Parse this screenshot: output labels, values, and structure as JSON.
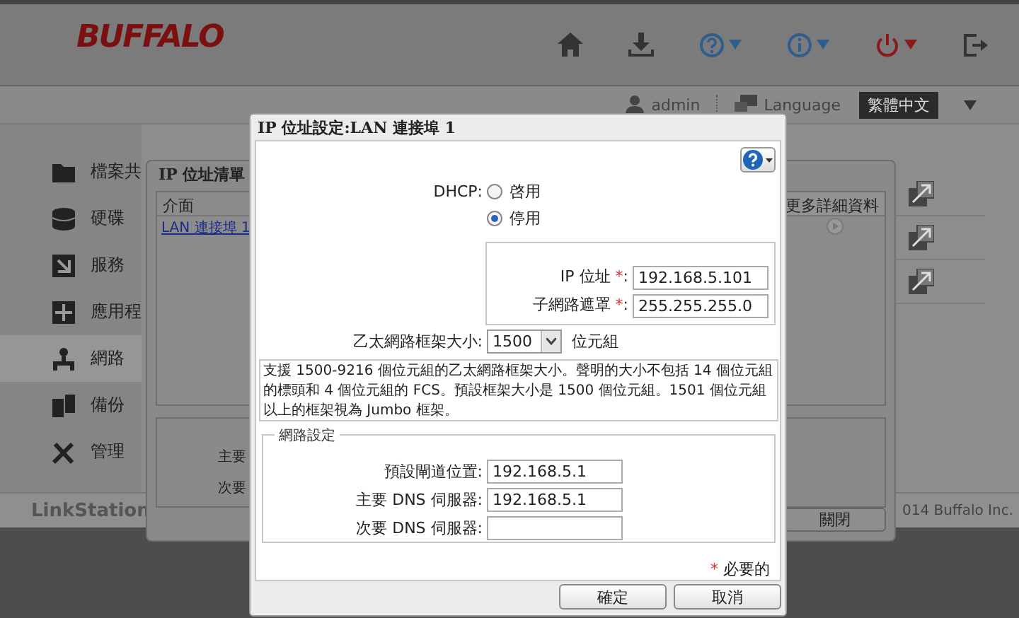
{
  "header": {
    "logo": "BUFFALO"
  },
  "user_bar": {
    "user": "admin",
    "language_label": "Language",
    "language": "繁體中文"
  },
  "sidebar": {
    "items": [
      {
        "label": "檔案共",
        "selected": false
      },
      {
        "label": "硬碟",
        "selected": false
      },
      {
        "label": "服務",
        "selected": false
      },
      {
        "label": "應用程",
        "selected": false
      },
      {
        "label": "網路",
        "selected": true
      },
      {
        "label": "備份",
        "selected": false
      },
      {
        "label": "管理",
        "selected": false
      }
    ]
  },
  "footer": {
    "product": "LinkStation",
    "copyright": "014 Buffalo Inc."
  },
  "ip_list_dialog": {
    "title": "IP 位址清單",
    "columns": [
      "介面",
      "更多詳細資料"
    ],
    "rows": [
      {
        "interface": "LAN 連接埠 1"
      }
    ],
    "labels": [
      "主要",
      "次要"
    ],
    "close_button": "關閉"
  },
  "ip_dialog": {
    "title": "IP 位址設定:LAN 連接埠 1",
    "dhcp": {
      "label": "DHCP:",
      "options": [
        {
          "label": "啓用",
          "selected": false
        },
        {
          "label": "停用",
          "selected": true
        }
      ]
    },
    "static_fields": [
      {
        "label": "IP 位址",
        "required_mark": "*",
        "label_end": ":",
        "value": "192.168.5.101"
      },
      {
        "label": "子網路遮罩",
        "required_mark": "*",
        "label_end": ":",
        "value": "255.255.255.0"
      }
    ],
    "frame_size": {
      "label": "乙太網路框架大小:",
      "value": "1500",
      "unit": "位元組"
    },
    "note": "支援 1500-9216 個位元組的乙太網路框架大小。聲明的大小不包括 14 個位元組的標頭和 4 個位元組的 FCS。預設框架大小是 1500 個位元組。1501 個位元組以上的框架視為 Jumbo 框架。",
    "network_settings": {
      "legend": "網路設定",
      "fields": [
        {
          "label": "預設閘道位置:",
          "value": "192.168.5.1"
        },
        {
          "label": "主要 DNS 伺服器:",
          "value": "192.168.5.1"
        },
        {
          "label": "次要 DNS 伺服器:"
        }
      ]
    },
    "required_note": {
      "mark": "*",
      "text": "必要的"
    },
    "buttons": [
      "確定",
      "取消"
    ]
  }
}
